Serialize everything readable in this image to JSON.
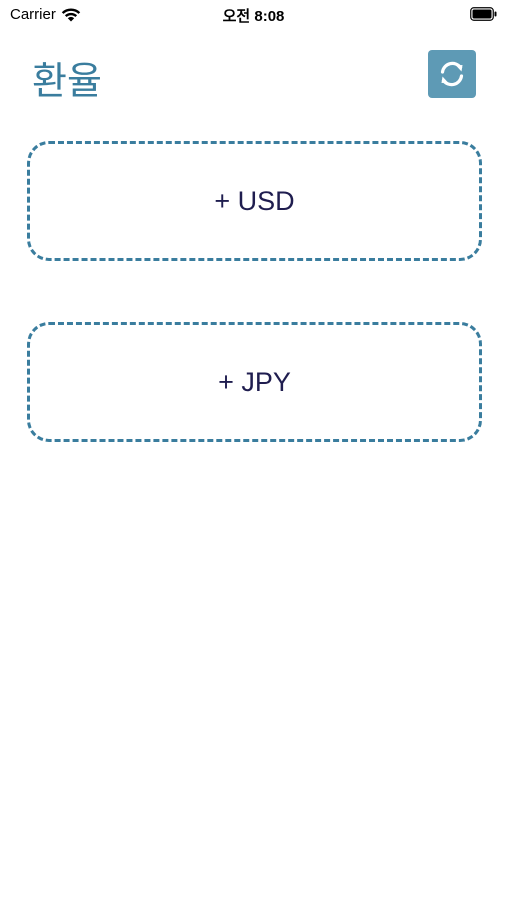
{
  "status_bar": {
    "carrier": "Carrier",
    "time": "오전 8:08",
    "wifi_icon": "wifi-icon",
    "battery_icon": "battery-icon"
  },
  "header": {
    "title": "환율",
    "refresh_icon": "refresh-icon",
    "title_color": "#3a7d9e",
    "button_color": "#5e9ab5"
  },
  "cards": [
    {
      "label": "+ USD"
    },
    {
      "label": "+ JPY"
    }
  ],
  "colors": {
    "border": "#3a7d9e",
    "label": "#1f1d4f"
  }
}
